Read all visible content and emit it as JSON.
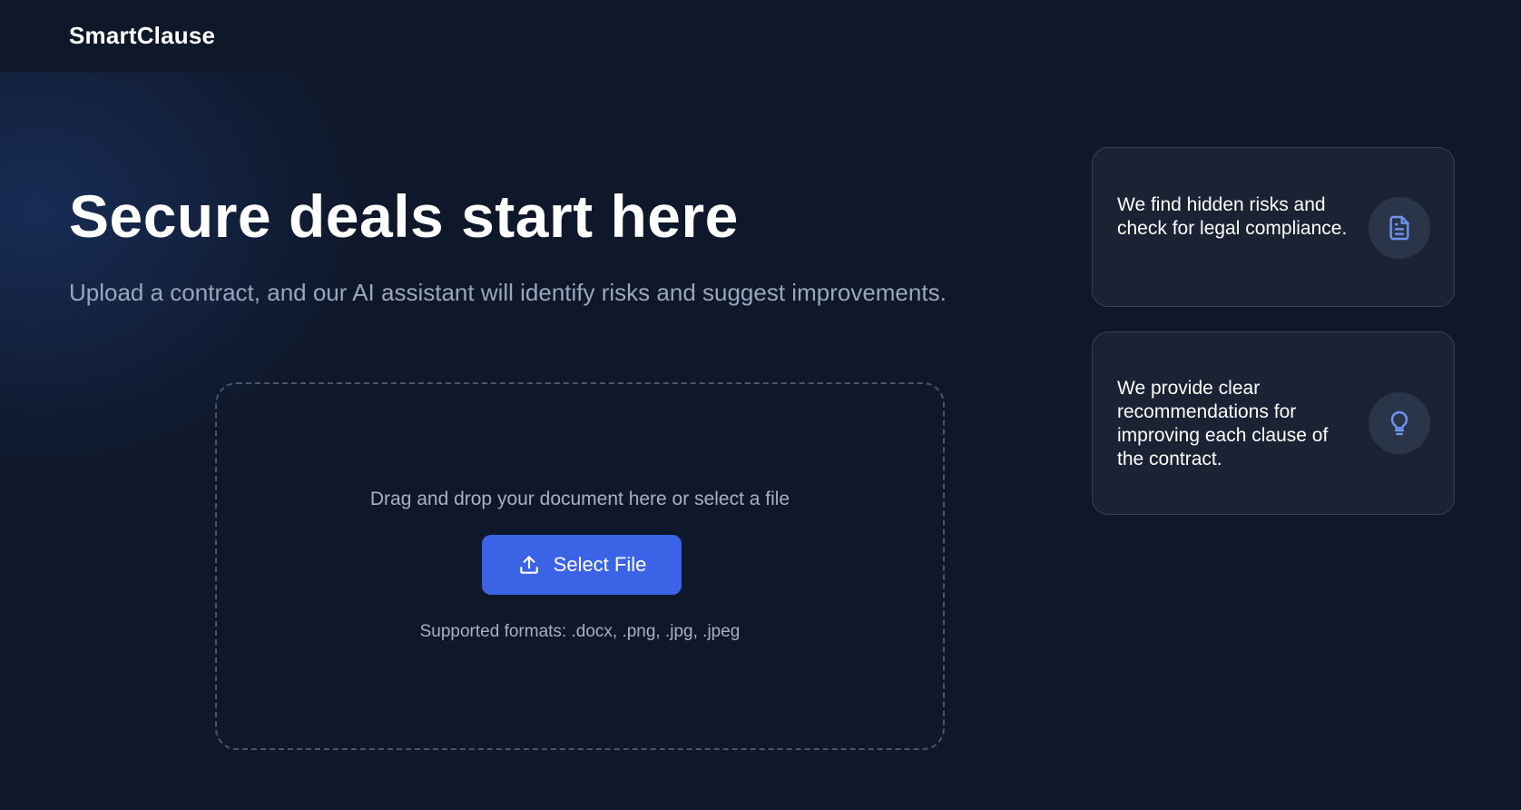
{
  "header": {
    "brand": "SmartClause"
  },
  "hero": {
    "title": "Secure deals start here",
    "subtitle": "Upload a contract, and our AI assistant will identify risks and suggest improvements."
  },
  "upload": {
    "drop_text": "Drag and drop your document here or select a file",
    "button_label": "Select File",
    "button_icon": "upload-icon",
    "formats_text": "Supported formats: .docx, .png, .jpg, .jpeg"
  },
  "features": [
    {
      "text": "We find hidden risks and check for legal compliance.",
      "icon": "document-icon"
    },
    {
      "text": "We provide clear recommendations for improving each clause of the contract.",
      "icon": "lightbulb-icon"
    }
  ],
  "colors": {
    "background": "#0f182a",
    "accent": "#3b63e6",
    "card_background": "#1a2233",
    "icon_accent": "#6e94f0",
    "muted_text": "#9aa6bb"
  }
}
